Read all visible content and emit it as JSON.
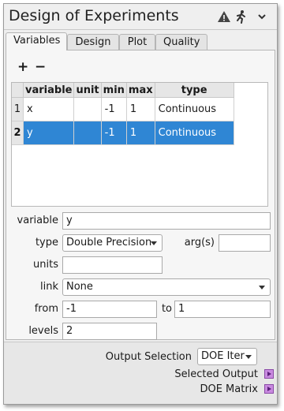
{
  "window": {
    "title": "Design of Experiments"
  },
  "titlebar_icons": [
    "warning-icon",
    "run-icon",
    "chevron-down-icon"
  ],
  "tabs": [
    {
      "label": "Variables",
      "active": true
    },
    {
      "label": "Design",
      "active": false
    },
    {
      "label": "Plot",
      "active": false
    },
    {
      "label": "Quality",
      "active": false
    }
  ],
  "toolbar": {
    "add_label": "+",
    "remove_label": "−"
  },
  "table": {
    "columns": [
      "variable",
      "unit",
      "min",
      "max",
      "type"
    ],
    "rows": [
      {
        "index": "1",
        "variable": "x",
        "unit": "",
        "min": "-1",
        "max": "1",
        "type": "Continuous",
        "selected": false
      },
      {
        "index": "2",
        "variable": "y",
        "unit": "",
        "min": "-1",
        "max": "1",
        "type": "Continuous",
        "selected": true
      }
    ]
  },
  "form": {
    "variable_label": "variable",
    "variable_value": "y",
    "type_label": "type",
    "type_value": "Double Precision",
    "args_label": "arg(s)",
    "args_value": "",
    "units_label": "units",
    "units_value": "",
    "link_label": "link",
    "link_value": "None",
    "from_label": "from",
    "from_value": "-1",
    "to_label": "to",
    "to_value": "1",
    "levels_label": "levels",
    "levels_value": "2"
  },
  "bottom": {
    "output_selection_label": "Output Selection",
    "output_selection_value": "DOE Iter",
    "selected_output_label": "Selected Output",
    "doe_matrix_label": "DOE Matrix"
  },
  "colors": {
    "selection": "#2f86d4",
    "port": "#c98ae0"
  }
}
